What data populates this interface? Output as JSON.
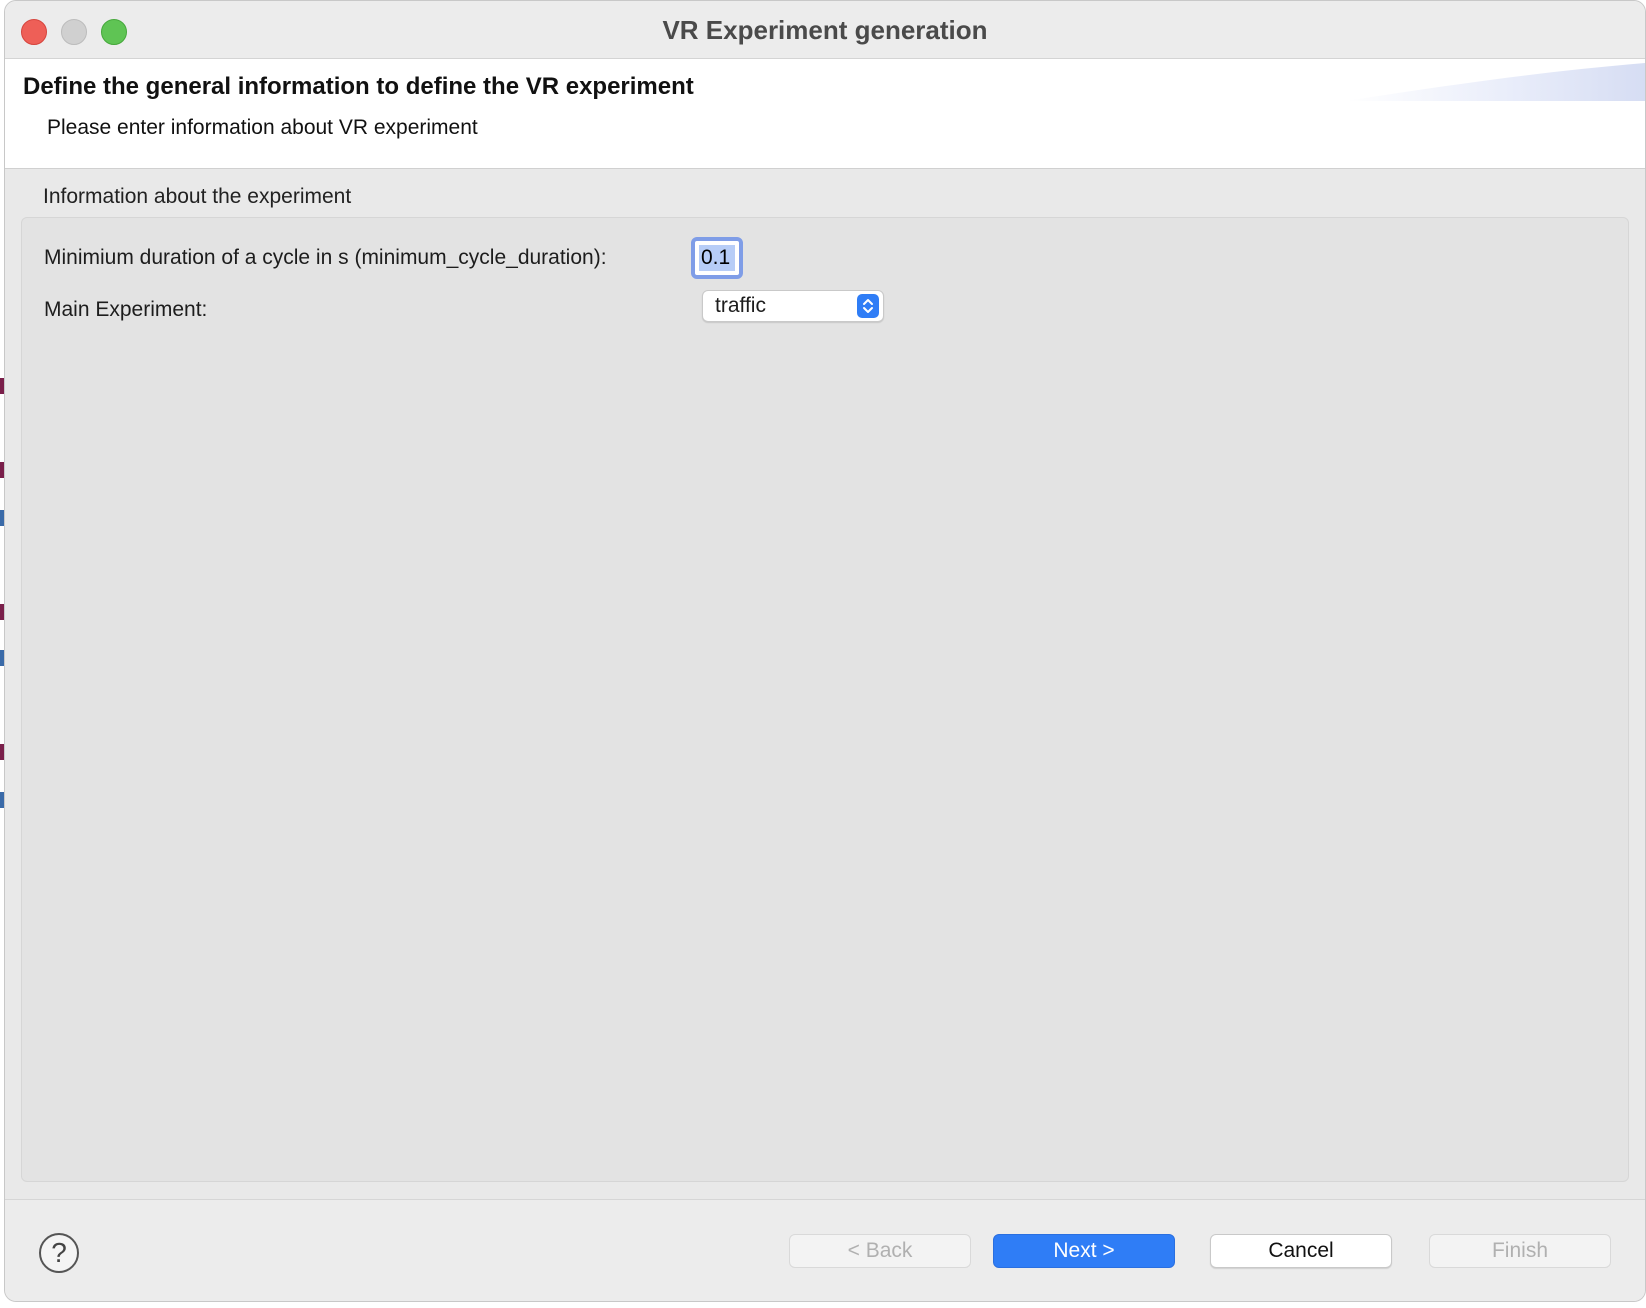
{
  "window": {
    "title": "VR Experiment generation"
  },
  "header": {
    "title": "Define the general information to define the VR experiment",
    "subtitle": "Please enter information about VR experiment"
  },
  "group": {
    "label": "Information about the experiment",
    "fields": {
      "cycle_label": "Minimium duration of a cycle in s (minimum_cycle_duration):",
      "cycle_value": "0.1",
      "main_label": "Main Experiment:",
      "main_value": "traffic"
    }
  },
  "footer": {
    "help_glyph": "?",
    "back_label": "< Back",
    "next_label": "Next >",
    "cancel_label": "Cancel",
    "finish_label": "Finish"
  },
  "colors": {
    "accent": "#2f7df6",
    "focus_ring": "#7f9de7",
    "close": "#ee5f57",
    "maximize": "#5fc454"
  }
}
